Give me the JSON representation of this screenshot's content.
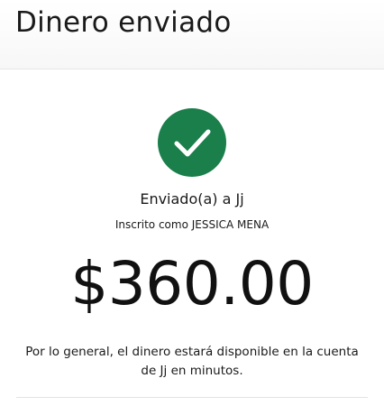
{
  "header": {
    "title": "Dinero enviado"
  },
  "status": {
    "icon": "check-circle-icon",
    "color": "#1a7f4a"
  },
  "recipient": {
    "sent_to": "Enviado(a) a Jj",
    "enrolled_as": "Inscrito como JESSICA MENA"
  },
  "transfer": {
    "amount": "$360.00",
    "availability_note": "Por lo general, el dinero estará disponible en la cuenta de Jj en minutos."
  }
}
